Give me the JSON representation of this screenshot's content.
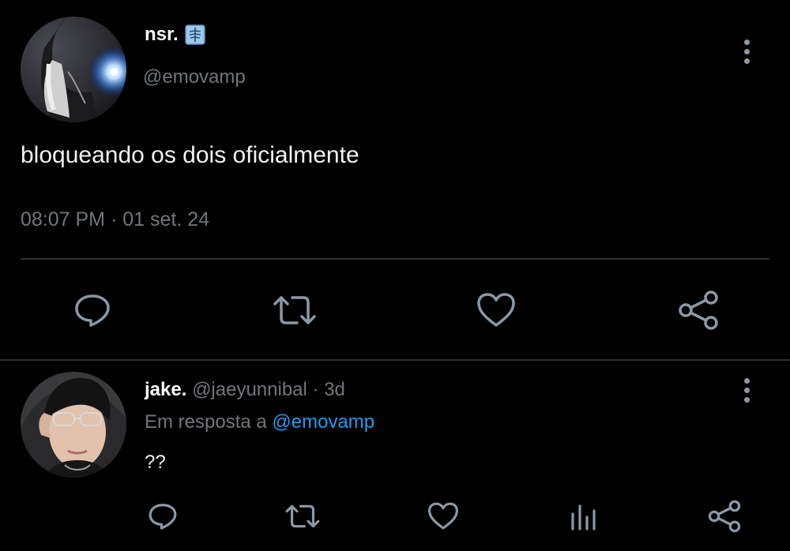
{
  "main_tweet": {
    "display_name": "nsr.",
    "badge_emoji": "🩻",
    "handle": "@emovamp",
    "text": "bloqueando os dois oficialmente",
    "timestamp": "08:07 PM · 01 set. 24"
  },
  "reply": {
    "display_name": "jake.",
    "handle": "@jaeyunnibal",
    "separator": "·",
    "age": "3d",
    "reply_prefix": "Em resposta a",
    "reply_to": "@emovamp",
    "text": "??"
  },
  "colors": {
    "background": "#000000",
    "text": "#e7e9ea",
    "secondary": "#71767b",
    "icon": "#8b98a5",
    "link": "#1d9bf0",
    "divider": "#2f3336"
  },
  "icons": {
    "main_actions": [
      "reply-icon",
      "retweet-icon",
      "like-icon",
      "share-icon"
    ],
    "reply_actions": [
      "reply-icon",
      "retweet-icon",
      "like-icon",
      "analytics-icon",
      "share-icon"
    ],
    "menu": "more-vertical-icon"
  }
}
